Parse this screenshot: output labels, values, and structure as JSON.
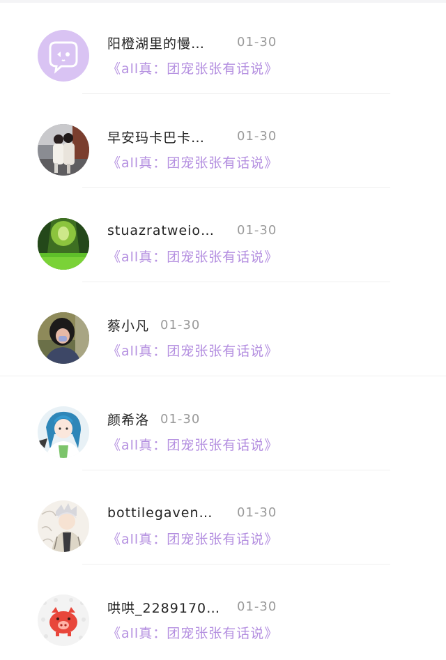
{
  "conversations": [
    {
      "name": "阳橙湖里的慢…",
      "date": "01-30",
      "message": "《all真：团宠张张有话说》",
      "avatar": "chat-bubble-icon"
    },
    {
      "name": "早安玛卡巴卡…",
      "date": "01-30",
      "message": "《all真：团宠张张有话说》",
      "avatar": "couple-photo"
    },
    {
      "name": "stuazratweio…",
      "date": "01-30",
      "message": "《all真：团宠张张有话说》",
      "avatar": "forest-photo"
    },
    {
      "name": "蔡小凡",
      "date": "01-30",
      "message": "《all真：团宠张张有话说》",
      "avatar": "girl-selfie"
    },
    {
      "name": "颜希洛",
      "date": "01-30",
      "message": "《all真：团宠张张有话说》",
      "avatar": "anime-girl"
    },
    {
      "name": "bottilegaven…",
      "date": "01-30",
      "message": "《all真：团宠张张有话说》",
      "avatar": "anime-samurai"
    },
    {
      "name": "哄哄_2289170…",
      "date": "01-30",
      "message": "《all真：团宠张张有话说》",
      "avatar": "pig-icon"
    }
  ],
  "colors": {
    "accent_text": "#b48fe0",
    "date_text": "#9a9a9a",
    "name_text": "#222222"
  }
}
